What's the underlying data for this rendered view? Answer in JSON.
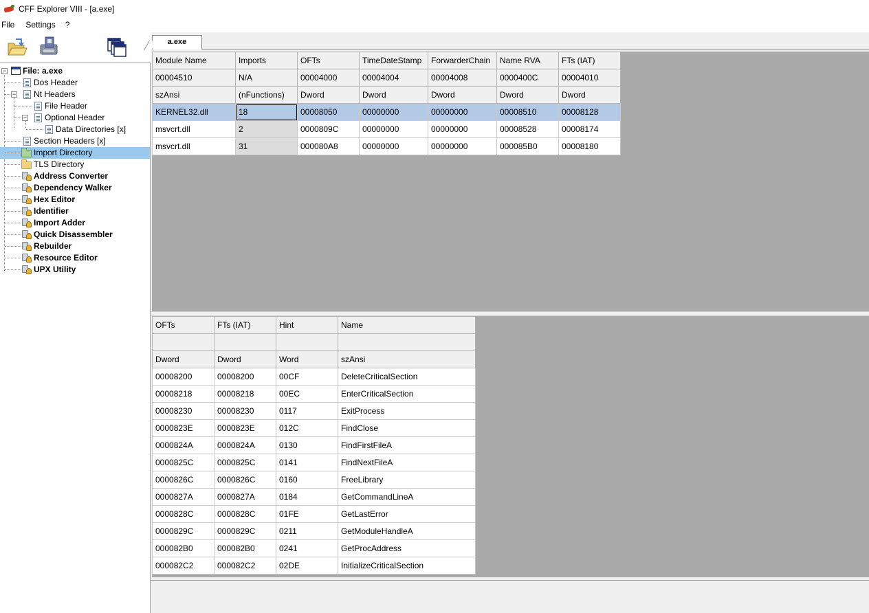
{
  "window": {
    "title": "CFF Explorer VIII - [a.exe]"
  },
  "menu": [
    "File",
    "Settings",
    "?"
  ],
  "toolbar": {
    "open_icon": "open-folder-icon",
    "save_icon": "save-disk-icon",
    "windows_icon": "windows-cascade-icon"
  },
  "tree": {
    "root": "File: a.exe",
    "items": [
      {
        "label": "Dos Header"
      },
      {
        "label": "Nt Headers"
      },
      {
        "label": "File Header"
      },
      {
        "label": "Optional Header"
      },
      {
        "label": "Data Directories [x]"
      },
      {
        "label": "Section Headers [x]"
      },
      {
        "label": "Import Directory"
      },
      {
        "label": "TLS Directory"
      }
    ],
    "tools": [
      "Address Converter",
      "Dependency Walker",
      "Hex Editor",
      "Identifier",
      "Import Adder",
      "Quick Disassembler",
      "Rebuilder",
      "Resource Editor",
      "UPX Utility"
    ]
  },
  "tab": {
    "label": "a.exe"
  },
  "imports_table": {
    "headers": [
      "Module Name",
      "Imports",
      "OFTs",
      "TimeDateStamp",
      "ForwarderChain",
      "Name RVA",
      "FTs (IAT)"
    ],
    "offsets": [
      "00004510",
      "N/A",
      "00004000",
      "00004004",
      "00004008",
      "0000400C",
      "00004010"
    ],
    "types": [
      "szAnsi",
      "(nFunctions)",
      "Dword",
      "Dword",
      "Dword",
      "Dword",
      "Dword"
    ],
    "rows": [
      [
        "KERNEL32.dll",
        "18",
        "00008050",
        "00000000",
        "00000000",
        "00008510",
        "00008128"
      ],
      [
        "msvcrt.dll",
        "2",
        "0000809C",
        "00000000",
        "00000000",
        "00008528",
        "00008174"
      ],
      [
        "msvcrt.dll",
        "31",
        "000080A8",
        "00000000",
        "00000000",
        "000085B0",
        "00008180"
      ]
    ]
  },
  "functions_table": {
    "headers": [
      "OFTs",
      "FTs (IAT)",
      "Hint",
      "Name"
    ],
    "offsets": [
      "",
      "",
      "",
      ""
    ],
    "types": [
      "Dword",
      "Dword",
      "Word",
      "szAnsi"
    ],
    "rows": [
      [
        "00008200",
        "00008200",
        "00CF",
        "DeleteCriticalSection"
      ],
      [
        "00008218",
        "00008218",
        "00EC",
        "EnterCriticalSection"
      ],
      [
        "00008230",
        "00008230",
        "0117",
        "ExitProcess"
      ],
      [
        "0000823E",
        "0000823E",
        "012C",
        "FindClose"
      ],
      [
        "0000824A",
        "0000824A",
        "0130",
        "FindFirstFileA"
      ],
      [
        "0000825C",
        "0000825C",
        "0141",
        "FindNextFileA"
      ],
      [
        "0000826C",
        "0000826C",
        "0160",
        "FreeLibrary"
      ],
      [
        "0000827A",
        "0000827A",
        "0184",
        "GetCommandLineA"
      ],
      [
        "0000828C",
        "0000828C",
        "01FE",
        "GetLastError"
      ],
      [
        "0000829C",
        "0000829C",
        "0211",
        "GetModuleHandleA"
      ],
      [
        "000082B0",
        "000082B0",
        "0241",
        "GetProcAddress"
      ],
      [
        "000082C2",
        "000082C2",
        "02DE",
        "InitializeCriticalSection"
      ]
    ]
  }
}
